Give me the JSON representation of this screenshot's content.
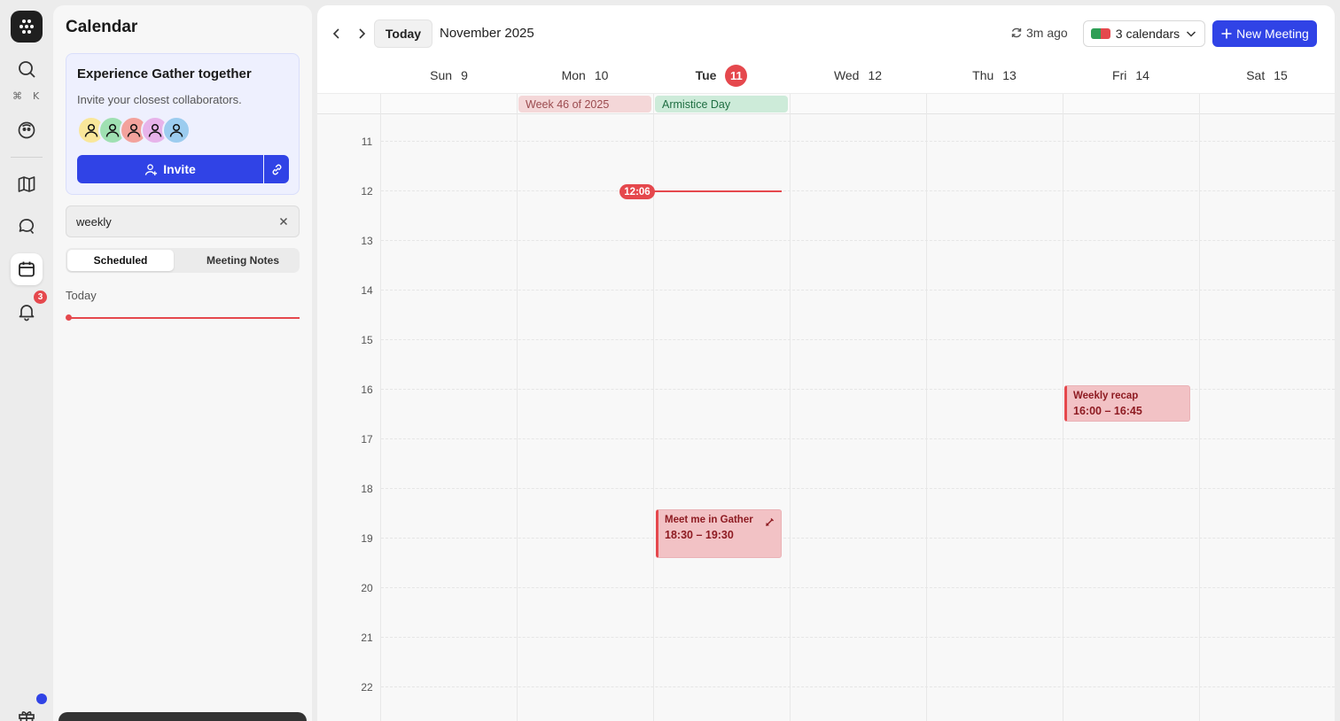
{
  "rail": {
    "shortcut_keys": [
      "⌘",
      "K"
    ],
    "notifications_count": "3"
  },
  "sidebar": {
    "title": "Calendar",
    "promo": {
      "title": "Experience Gather together",
      "subtitle": "Invite your closest collaborators.",
      "invite_label": "Invite"
    },
    "search": {
      "value": "weekly"
    },
    "tabs": [
      {
        "label": "Scheduled",
        "active": true
      },
      {
        "label": "Meeting Notes",
        "active": false
      }
    ],
    "section_label": "Today"
  },
  "toolbar": {
    "today_label": "Today",
    "month_label": "November 2025",
    "sync_label": "3m ago",
    "calendars_label": "3 calendars",
    "new_meeting_label": "New Meeting"
  },
  "days": [
    {
      "name": "Sun",
      "num": "9",
      "today": false
    },
    {
      "name": "Mon",
      "num": "10",
      "today": false
    },
    {
      "name": "Tue",
      "num": "11",
      "today": true
    },
    {
      "name": "Wed",
      "num": "12",
      "today": false
    },
    {
      "name": "Thu",
      "num": "13",
      "today": false
    },
    {
      "name": "Fri",
      "num": "14",
      "today": false
    },
    {
      "name": "Sat",
      "num": "15",
      "today": false
    }
  ],
  "all_day_events": [
    {
      "label": "Week 46 of 2025",
      "day": "Mon"
    },
    {
      "label": "Armistice Day",
      "day": "Tue"
    }
  ],
  "hours": [
    "11",
    "12",
    "13",
    "14",
    "15",
    "16",
    "17",
    "18",
    "19",
    "20",
    "21",
    "22"
  ],
  "now_label": "12:06",
  "events": [
    {
      "title": "Weekly recap",
      "time": "16:00 – 16:45",
      "day": "Fri"
    },
    {
      "title": "Meet me in Gather",
      "time": "18:30 – 19:30",
      "day": "Tue"
    }
  ],
  "colors": {
    "accent": "#3043e6",
    "today_red": "#e5484d",
    "event_fill": "#f2c2c5",
    "week_badge": "#f4d7d8",
    "holiday_badge": "#cdebd9",
    "avatars": [
      "#f9e79a",
      "#9fe0b2",
      "#f3a29c",
      "#e7b3ea",
      "#9cccef"
    ],
    "calendar_swatches": [
      "#2e9e55",
      "#e5484d"
    ]
  },
  "icons": {
    "logo": "gather-logo-icon",
    "search": "search-icon",
    "status": "face-icon",
    "map": "map-icon",
    "chat": "chat-icon",
    "calendar": "calendar-icon",
    "bell": "bell-icon",
    "gift": "gift-icon"
  }
}
